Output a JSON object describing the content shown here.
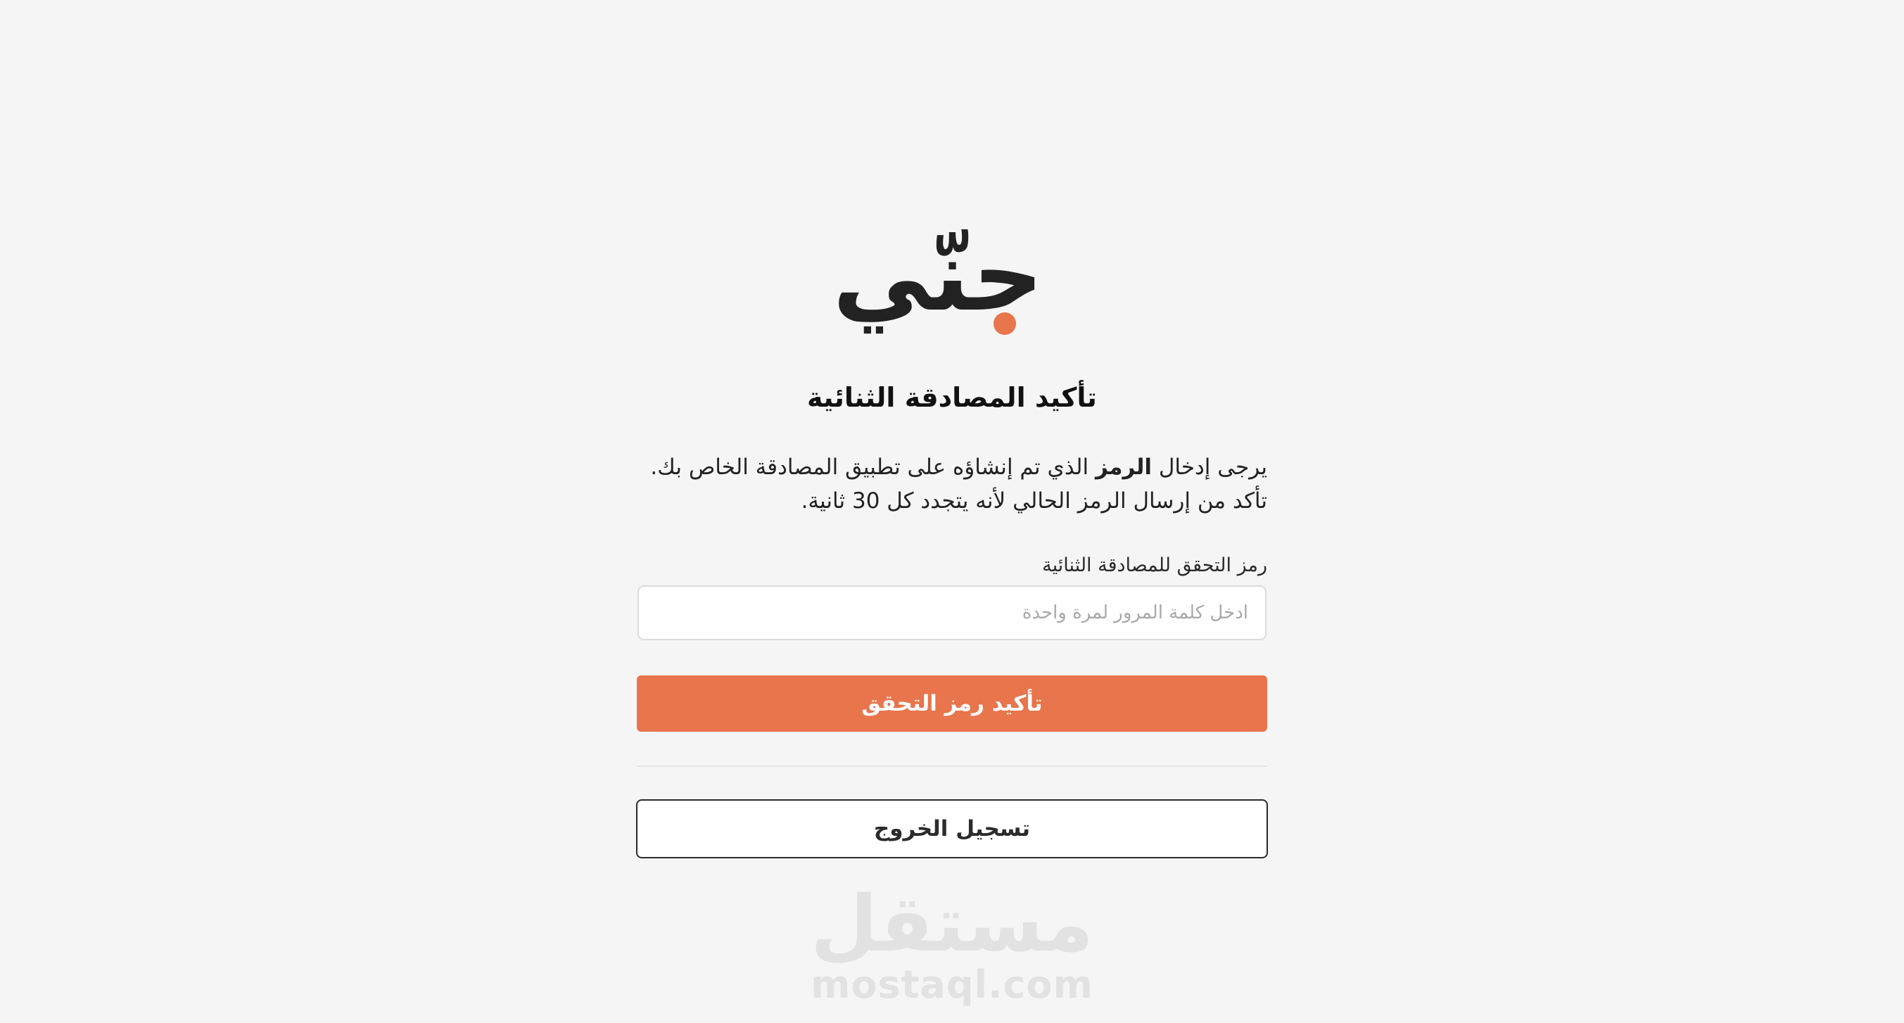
{
  "brand": {
    "logo_text": "جنّي",
    "dot_color": "#e8754c"
  },
  "page": {
    "title": "تأكيد المصادقة الثنائية"
  },
  "description": {
    "line1_before": "يرجى إدخال ",
    "line1_bold": "الرمز",
    "line1_after": " الذي تم إنشاؤه على تطبيق المصادقة الخاص بك.",
    "line2": "تأكد من إرسال الرمز الحالي لأنه يتجدد كل 30 ثانية."
  },
  "form": {
    "label": "رمز التحقق للمصادقة الثنائية",
    "placeholder": "ادخل كلمة المرور لمرة واحدة",
    "value": ""
  },
  "actions": {
    "verify_label": "تأكيد رمز التحقق",
    "verify_color": "#e8754c",
    "logout_label": "تسجيل الخروج"
  },
  "watermark": {
    "arabic": "مستقل",
    "latin": "mostaql.com"
  }
}
